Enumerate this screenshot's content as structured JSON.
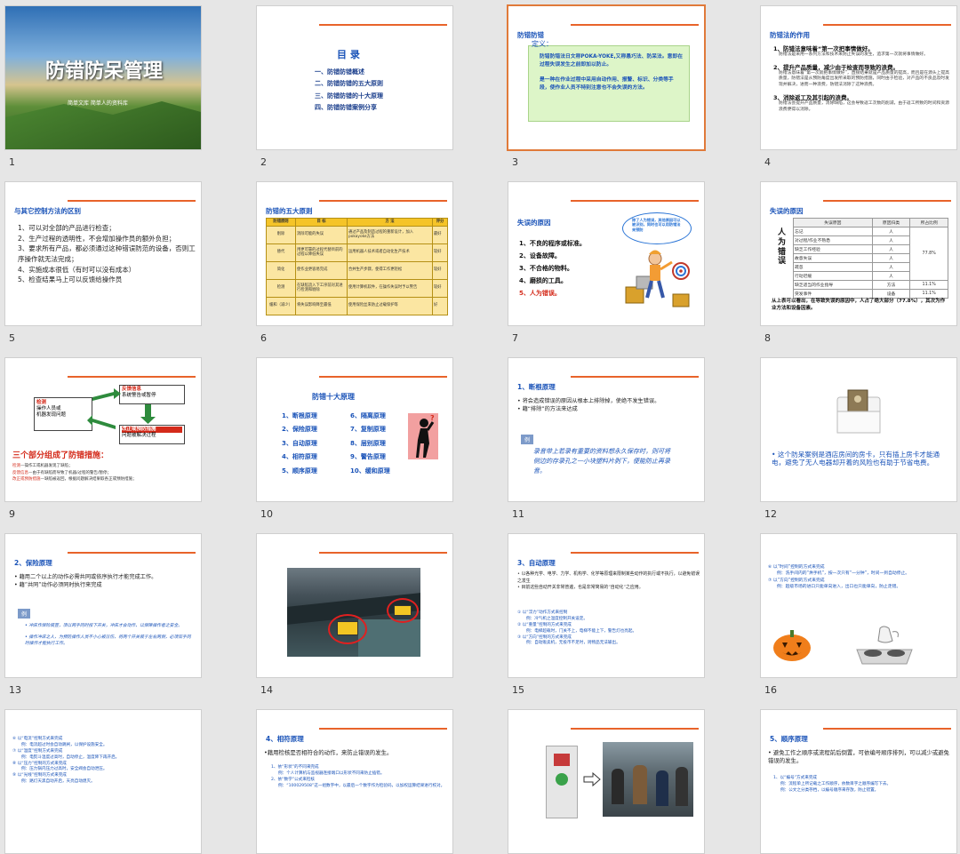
{
  "slides": [
    {
      "num": "1",
      "title": "防错防呆管理",
      "subtitle": "简单文库  简单人的资料库"
    },
    {
      "num": "2",
      "heading": "目  录",
      "items": [
        "一、防错防错概述",
        "二、防错防错的五大原则",
        "三、防错防错的十大原理",
        "四、防错防错案例分享"
      ]
    },
    {
      "num": "3",
      "title": "防错防错",
      "def_label": "定义：",
      "def_text": "防错防错法日文称POKA-YOKE,又称愚巧法、防呆法。意即在过程失误发生之前即加以防止。",
      "def_text2": "是一种在作业过程中采用自动作用、报警、标识、分类等手段，使作业人员不特别注意也不会失误的方法。"
    },
    {
      "num": "4",
      "title": "防错法的作用",
      "points": [
        {
          "h": "1、防错法意味着“第一次把事情做好。",
          "d": "防错法是采用一系列方法和技术来防止失误的发生，追求第一次就将事情做好。"
        },
        {
          "h": "2、提升产品质量，减少由于检查而导致的浪费。",
          "d": "防错法意味着“第一次就把事情做好”，直接结果就是产品质量的提高，而且是在源头上提高质量，防错法是从预防角度出发所采取的预防措施，同时由于检验，对产品的不良品及时发现并解决，进而一种浪费，防错法消除了这种浪费。"
        },
        {
          "h": "3、消除返工及其引起的浪费。",
          "d": "防错法会提升产品质量，消除缺陷，这会导致返工次数的削减，由于返工所致的时间和资源浪费便得以消除。"
        }
      ]
    },
    {
      "num": "5",
      "title": "与其它控制方法的区别",
      "items": [
        "1、可以对全部的产品进行检查；",
        "2、生产过程的透明性，不会增加操作员的额外负担；",
        "3、要求所有产品，都必须通过这种错误防范的设备，否则工序操作就无法完成；",
        "4、实施成本很低（有时可以没有成本）",
        "5、检查结果马上可以反馈给操作员"
      ]
    },
    {
      "num": "6",
      "title": "防错的五大原则",
      "headers": [
        "防错原则",
        "目  标",
        "方  法",
        "评分"
      ],
      "rows": [
        [
          "削除",
          "消除可能的失误",
          "通过产品及制造过程的重新设计，加入pokayoke方法",
          "最好"
        ],
        [
          "替代",
          "用更可靠的过程代替目前的过程以降低失误",
          "运用机器人技术或者自动化生产技术",
          "较好"
        ],
        [
          "简化",
          "使作业更容易完成",
          "合并生产步骤，使得工作更轻松",
          "较好"
        ],
        [
          "检测",
          "在缺陷流入下工序前对其进行检测和剔除",
          "使用计算机软件，在操作失误时予以警告",
          "较好"
        ],
        [
          "缓和（减少）",
          "将失误影响降至最低",
          "使用保险丝来防止过载保护等",
          "好"
        ]
      ]
    },
    {
      "num": "7",
      "title": "失误的原因",
      "bubble": "除了人为错误，其他原因可以被识别，同时也可以用防错法来预防",
      "items": [
        "1、不良的程序或标准。",
        "2、设备故障。",
        "3、不合格的物料。",
        "4、磨损的工具。",
        "5、人为错误。"
      ]
    },
    {
      "num": "8",
      "title": "失误的原因",
      "side_label": "人为错误",
      "headers": [
        "失误原因",
        "原因归类",
        "所占比例"
      ],
      "rows": [
        [
          "忘记",
          "人"
        ],
        [
          "对过程/作业不熟悉",
          "人"
        ],
        [
          "缺乏工作经验",
          "人"
        ],
        [
          "故意失误",
          "人"
        ],
        [
          "疏忽",
          "人"
        ],
        [
          "行动迟缓",
          "人"
        ],
        [
          "缺乏适当的作业指导",
          "方法"
        ],
        [
          "突发事件",
          "设备"
        ]
      ],
      "human_pct": "77.8%",
      "method_pct": "11.1%",
      "equip_pct": "11.1%",
      "note": "从上表可以看出，在导致失误的原因中，人占了绝大部分（77.8%），其次为作业方法和设备因素。"
    },
    {
      "num": "9",
      "box1_title": "检测",
      "box1_lines": [
        "操作人员或",
        "机器发现问题"
      ],
      "box2_title": "反馈信息",
      "box2_text": "系统警告或暂停",
      "box3_title": "改正或预防措施",
      "box3_text": "问题被解决过程",
      "heading": "三个部分组成了防错措施：",
      "lines": [
        {
          "k": "检测",
          "v": "—操作工或机器发现了缺陷；"
        },
        {
          "k": "反馈信息",
          "v": "—由于有缺陷而导致了机器/过程的警告/暂停；"
        },
        {
          "k": "改正或预防措施",
          "v": "—缺陷被返回，根据问题解决结果取各正或预防措施；"
        }
      ]
    },
    {
      "num": "10",
      "title": "防错十大原理",
      "left": [
        "1、断根原理",
        "2、保险原理",
        "3、自动原理",
        "4、相符原理",
        "5、顺序原理"
      ],
      "right": [
        "6、隔离原理",
        "7、复制原理",
        "8、层别原理",
        "9、警告原理",
        "10、缓和原理"
      ]
    },
    {
      "num": "11",
      "title": "1、断根原理",
      "bullets": [
        "将会造成错误的原因从根本上排除掉，使绝不发生错误。",
        "藉“排除”的方法来达成"
      ],
      "ex_label": "例",
      "example": "录音带上若录有重要的资料想永久保存时，则可将侧边的存录孔之一小块塑料片剥下，便能防止再录音。"
    },
    {
      "num": "12",
      "bullet": "这个防呆案例是酒店房间的房卡，只有插上房卡才能通电，避免了无人电器却开着的风险也有助于节省电费。"
    },
    {
      "num": "13",
      "title": "2、保险原理",
      "bullets": [
        "藉用二个以上的动作必需共同或依序执行才能完成工作。",
        "藉“共同”动作必须同时执行来完成"
      ],
      "ex_label": "例",
      "examples": [
        "冲床作保险装置，须以两手同时按下开关，冲床才会动作，以保障操作者之安全。",
        "操作冲床之人，为预防操作人员不小心被压伤，将两个开关装于左右两侧，必须双手同时操作才能执行工作。"
      ]
    },
    {
      "num": "14"
    },
    {
      "num": "15",
      "title": "3、自动原理",
      "bullets": [
        "以各种光学、电学、力学、机构学、化学等原理来限制某些动作的执行或不执行，以避免错误之发生",
        "目前这些自动开关非常普遍，也是非常简易的“自动化”之应用。"
      ],
      "subs": [
        {
          "h": "以“浮力”动作方式来控制",
          "d": "例：冷气机之温度控制开关设定。"
        },
        {
          "h": "以“重量”控制的方式来完成",
          "d": "例：电梯超载时，门关不上，电梯不能上下，警告灯也亮起。"
        },
        {
          "h": "以“方向”控制的方式来完成",
          "d": "例：自动贩卖机，无投币不足时，则物品无法输出。"
        }
      ]
    },
    {
      "num": "16",
      "subs": [
        {
          "h": "以“时间”控制的方式来完成",
          "d": "例：洗手间内的“烘手机”，按一次只有“一分钟”，时间一到自动停止。"
        },
        {
          "h": "以“方向”控制的方式来完成",
          "d": "例：超级市场的进口只能单向进入，出口也只能单向，防止走错。"
        }
      ]
    },
    {
      "num": "17",
      "subs": [
        {
          "h": "以“电流”控制方式来完成",
          "d": "例：电流超过时会自动跳闸，以保护设施安全。"
        },
        {
          "h": "以“温度”控制方式来完成",
          "d": "例：电熨斗温度过高时，自动停止，温度降下再开启。"
        },
        {
          "h": "以“压力”控制的方式来完成",
          "d": "例：压力锅内压力过高时，安全阀会自动泄压。"
        },
        {
          "h": "以“光线”控制的方式来完成",
          "d": "例：路灯天黑自动开启，天亮自动熄灭。"
        }
      ]
    },
    {
      "num": "18",
      "title": "4、相符原理",
      "bullet": "藉用检核是否相符合的动作，来防止错误的发生。",
      "subs": [
        {
          "h": "1、依“形状”的不同来完成",
          "d": "例：个人计算机与监视器连接端口以形状不同来防止插错。"
        },
        {
          "h": "2、依“数学”公式来检核",
          "d": "例：“100029508”这一组数字中，以最后一个数字作为检验码，以加权运算结果进行校对。"
        }
      ]
    },
    {
      "num": "19"
    },
    {
      "num": "20",
      "title": "5、顺序原理",
      "bullet": "避免工作之顺序或流程前后倒置，可依编号顺序排列，可以减少或避免错误的发生。",
      "subs": [
        {
          "h": "1、以“编号”方式来完成",
          "d": "例：流程单上所记载之工作顺序，依数目字之顺序编写下去。"
        },
        {
          "h": "",
          "d": "例：公文之分类存档，以编号顺序来存放，防止错置。"
        }
      ]
    }
  ]
}
